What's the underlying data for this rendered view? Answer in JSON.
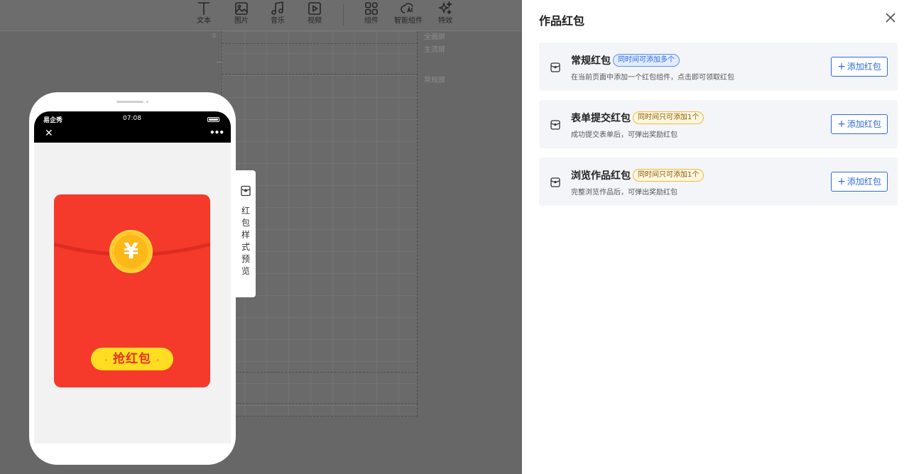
{
  "toolbar": {
    "tools": [
      {
        "label": "文本",
        "icon": "text-icon"
      },
      {
        "label": "图片",
        "icon": "image-icon"
      },
      {
        "label": "音乐",
        "icon": "music-icon"
      },
      {
        "label": "视频",
        "icon": "video-icon"
      },
      {
        "label": "组件",
        "icon": "components-icon"
      },
      {
        "label": "智能组件",
        "icon": "ai-components-icon"
      },
      {
        "label": "特效",
        "icon": "effects-icon"
      }
    ]
  },
  "canvas": {
    "screen_labels": [
      "全面屏",
      "主流屏",
      "常规屏"
    ],
    "ruler_mark": "0"
  },
  "phone": {
    "carrier": "易企秀",
    "time": "07:08",
    "close_glyph": "✕",
    "more_glyph": "•••",
    "envelope": {
      "currency_symbol": "¥",
      "button_label": "抢红包",
      "button_dot": "·"
    }
  },
  "preview_tab": {
    "label": "红包样式预览",
    "icon": "red-packet-icon"
  },
  "panel": {
    "title": "作品红包",
    "cards": [
      {
        "title": "常规红包",
        "badge": "同时间可添加多个",
        "badge_style": "blue",
        "desc": "在当前页面中添加一个红包组件，点击即可领取红包",
        "button": "添加红包"
      },
      {
        "title": "表单提交红包",
        "badge": "同时间只可添加1个",
        "badge_style": "orange",
        "desc": "成功提交表单后，可弹出奖励红包",
        "button": "添加红包"
      },
      {
        "title": "浏览作品红包",
        "badge": "同时间只可添加1个",
        "badge_style": "orange",
        "desc": "完整浏览作品后，可弹出奖励红包",
        "button": "添加红包"
      }
    ],
    "button_plus": "+"
  },
  "colors": {
    "accent_blue": "#2f6ae0",
    "envelope_red": "#f5392b",
    "coin_gold": "#fcb718",
    "button_yellow": "#ffdd22"
  }
}
